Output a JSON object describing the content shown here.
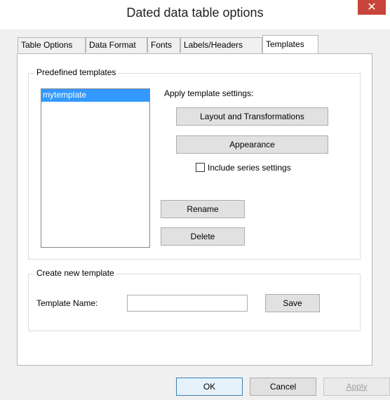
{
  "window": {
    "title": "Dated data table options",
    "close_symbol": "✕"
  },
  "tabs": [
    {
      "label": "Table Options",
      "active": false
    },
    {
      "label": "Data Format",
      "active": false
    },
    {
      "label": "Fonts",
      "active": false
    },
    {
      "label": "Labels/Headers",
      "active": false
    },
    {
      "label": "Templates",
      "active": true
    }
  ],
  "predefined": {
    "group_label": "Predefined templates",
    "templates": [
      "mytemplate"
    ],
    "selected": "mytemplate",
    "apply_label": "Apply template settings:",
    "layout_button": "Layout and Transformations",
    "appearance_button": "Appearance",
    "include_series_label": "Include series settings",
    "include_series_checked": false,
    "rename_button": "Rename",
    "delete_button": "Delete"
  },
  "create": {
    "group_label": "Create new template",
    "name_label": "Template Name:",
    "name_value": "",
    "save_button": "Save"
  },
  "footer": {
    "ok": "OK",
    "cancel": "Cancel",
    "apply": "Apply"
  }
}
